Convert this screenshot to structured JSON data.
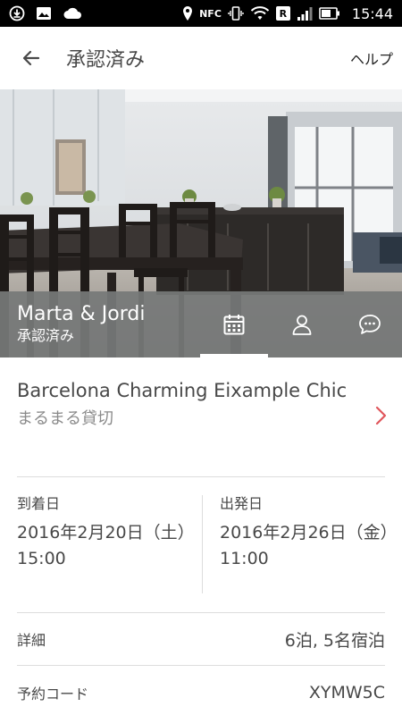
{
  "status_bar": {
    "time": "15:44",
    "nfc": "NFC",
    "roaming": "R"
  },
  "app_bar": {
    "title": "承認済み",
    "help": "ヘルプ"
  },
  "host": {
    "name": "Marta & Jordi",
    "status": "承認済み"
  },
  "listing": {
    "name": "Barcelona Charming Eixample Chic",
    "type": "まるまる貸切"
  },
  "checkin": {
    "label": "到着日",
    "date": "2016年2月20日（土）",
    "time": "15:00"
  },
  "checkout": {
    "label": "出発日",
    "date": "2016年2月26日（金）",
    "time": "11:00"
  },
  "details": {
    "label": "詳細",
    "value": "6泊, 5名宿泊"
  },
  "code": {
    "label": "予約コード",
    "value": "XYMW5C"
  },
  "colors": {
    "accent": "#E0565B",
    "overlay": "#767979"
  }
}
